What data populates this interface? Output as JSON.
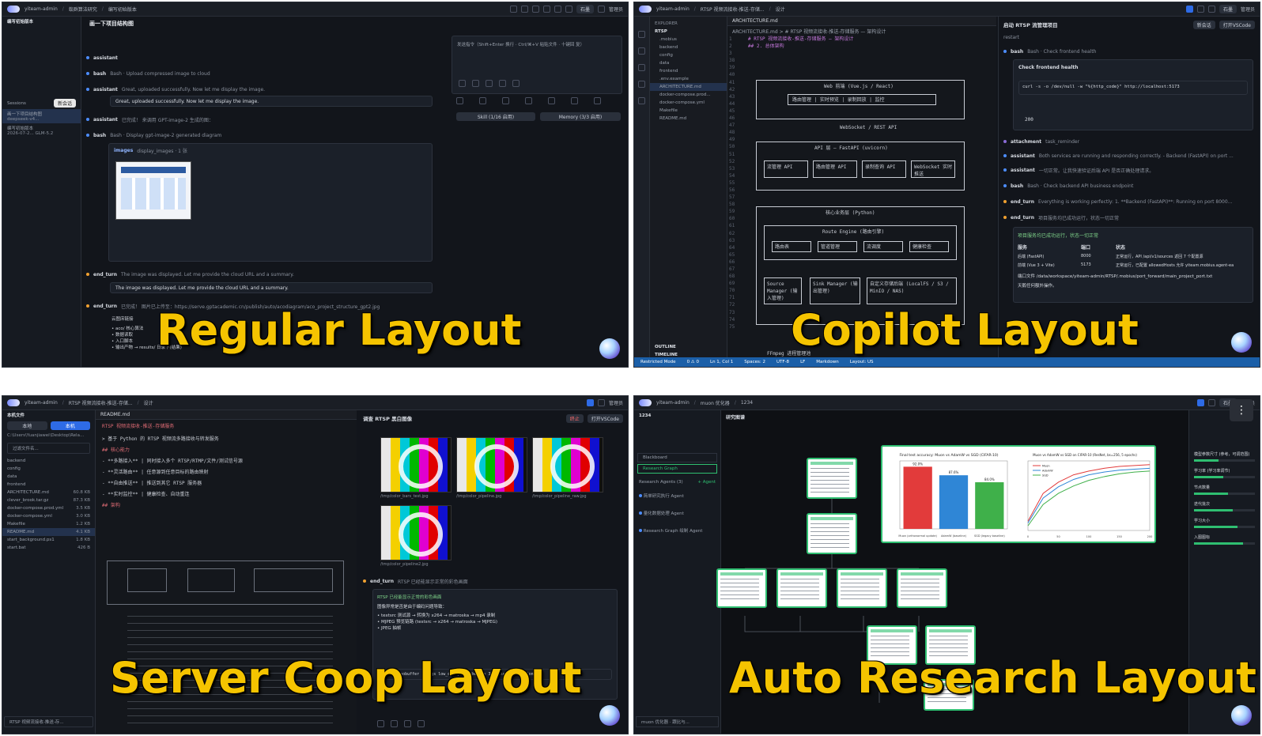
{
  "labels": {
    "regular": "Regular Layout",
    "copilot": "Copilot Layout",
    "coop": "Server Coop Layout",
    "research": "Auto Research Layout"
  },
  "regular": {
    "crumbs": [
      "yiteam-admin",
      "蚁群算法研究",
      "编写初始版本"
    ],
    "header_title": "编写初始版本",
    "tab_title": "画一下项目结构图",
    "stop_label": "终止",
    "open_vscode": "打开VSCode",
    "admin": "管理员",
    "stone": "石墨",
    "sessions_label": "Sessions",
    "new_session": "新会话",
    "sidebar_items": [
      "画一下项目结构图",
      "编写初始版本"
    ],
    "sidebar_models": [
      "deepseek-v4...",
      "GLM-5.2"
    ],
    "sidebar_date": "2026-07-2...",
    "events": [
      {
        "tag": "assistant",
        "text": ""
      },
      {
        "tag": "bash",
        "text": "Bash · Upload compressed image to cloud"
      },
      {
        "tag": "assistant",
        "text": "Great, uploaded successfully. Now let me display the image."
      },
      {
        "tag": "assistant",
        "text": "已完成！ 来调用 GPT-image-2 生成的图："
      },
      {
        "tag": "bash",
        "text": "Bash · Display gpt-image-2 generated diagram"
      },
      {
        "tag": "images",
        "text": "display_images · 1 张"
      },
      {
        "tag": "end_turn",
        "text": "The image was displayed. Let me provide the cloud URL and a summary."
      },
      {
        "tag": "end_turn",
        "text": "已完成！ 图片已上传至：https://serve.gptacademic.cn/publish/auto/acodiagram/aco_project_structure_gpt2.jpg"
      }
    ],
    "result_line": "Great, uploaded successfully. Now let me display the image.",
    "result_line2": "The image was displayed. Let me provide the cloud URL and a summary.",
    "url_label": "云图床链接",
    "bullets": [
      "aco/ 核心算法",
      "数据读取",
      "入口脚本",
      "输出产物 → results/ 日录下(结果)"
    ],
    "input_placeholder": "发送指令（Shift+Enter 换行 · Ctrl/⌘+V 粘贴文件 · 十键回 复）",
    "skill": "Skill (1/16 启用)",
    "memory": "Memory (3/3 启用)"
  },
  "copilot": {
    "crumbs": [
      "yiteam-admin",
      "RTSP 视频流接收-推送-存储...",
      "设计"
    ],
    "explorer": "EXPLORER",
    "rtsp": "RTSP",
    "tree": [
      ".mobius",
      "backend",
      "config",
      "data",
      "frontend",
      ".env.example",
      "ARCHITECTURE.md",
      "docker-compose.prod...",
      "docker-compose.yml",
      "Makefile",
      "README.md"
    ],
    "outline": "OUTLINE",
    "timeline": "TIMELINE",
    "tab": "ARCHITECTURE.md",
    "path": "ARCHITECTURE.md > # RTSP 视频流接收-推送-存储服务 — 架构设计",
    "line1": "# RTSP 视频流接收-推送-存储服务 — 架构设计",
    "line2": "## 2. 总体架构",
    "web": "Web 前端 (Vue.js / React)",
    "web_sub": "路由管理 | 实时预览 | 录制回放 | 监控",
    "ws": "WebSocket / REST API",
    "api": "API 层 — FastAPI (uvicorn)",
    "apis": [
      "流管理 API",
      "路由管理 API",
      "录制查询 API",
      "WebSocket 实时推送"
    ],
    "core": "核心业务层 (Python)",
    "route": "Route Engine (路由引擎)",
    "route_items": [
      "路由表",
      "管道管理",
      "流调度",
      "健康检查"
    ],
    "src": "Source Manager (输入管理)",
    "sink": "Sink Manager (输出管理)",
    "store": "自定义存储后端 (LocalFS / S3 / MinIO / NAS)",
    "ffmpeg": "FFmpeg 进程管理池",
    "status": [
      "Restricted Mode",
      "0 ⚠ 0",
      "Ln 1, Col 1",
      "Spaces: 2",
      "UTF-8",
      "LF",
      "Markdown",
      "Layout: US"
    ],
    "panel_title": "启动 RTSP 流管理项目",
    "panel_add": "新会话",
    "panel_restart": "restart",
    "check_title": "Check frontend health",
    "curl": "curl -s -o /dev/null -w \"%{http_code}\" http://localhost:5173",
    "code200": "200",
    "events": [
      {
        "tag": "bash",
        "text": "Bash · Check frontend health"
      },
      {
        "tag": "attachment",
        "text": "task_reminder"
      },
      {
        "tag": "assistant",
        "text": "Both services are running and responding correctly. - Backend (FastAPI) on port ..."
      },
      {
        "tag": "assistant",
        "text": "一切正常。让我快速验证后端 API 是否正确处理请求。"
      },
      {
        "tag": "bash",
        "text": "Bash · Check backend API business endpoint"
      },
      {
        "tag": "end_turn",
        "text": "Everything is working perfectly: 1. **Backend (FastAPI)**: Running on port 8000..."
      },
      {
        "tag": "end_turn",
        "text": "项目服务均已成功运行，状态一切正常"
      }
    ],
    "table_head": [
      "服务",
      "端口",
      "状态"
    ],
    "table_rows": [
      [
        "后端 (FastAPI)",
        "8000",
        "正常运行，API /api/v1/sources 返回 7 个配置源"
      ],
      [
        "前端 (Vue 3 + Vite)",
        "5173",
        "正常运行，已配置 allowedHosts 允许 yiteam.mobius.agent-ea"
      ]
    ],
    "port_file": "端口文件 /data/workspace/yiteam-admin/RTSP/.mobius/port_forward/main_project_port.txt",
    "ready": "天鹅任何额外操作。"
  },
  "coop": {
    "crumbs": [
      "yiteam-admin",
      "RTSP 视频流接收-推送-存储...",
      "设计"
    ],
    "files_label": "本机文件",
    "tabs": [
      "本地",
      "本机"
    ],
    "path": "C:\\Users\\Yuanjiawei\\Desktop\\Rela...",
    "filter": "过滤文件名...",
    "tree": [
      "backend",
      "config",
      "data",
      "frontend",
      "ARCHITECTURE.md",
      "clever_brook.tar.gz",
      "docker-compose.prod.yml",
      "docker-compose.yml",
      "Makefile",
      "README.md",
      "start_background.ps1",
      "start.bat"
    ],
    "sizes": [
      "",
      "",
      "",
      "",
      "60.8 KB",
      "87.3 KB",
      "3.5 KB",
      "3.0 KB",
      "1.2 KB",
      "4.1 KB",
      "1.8 KB",
      "426 B"
    ],
    "session": "RTSP 视频流接收-推送-存...",
    "editor_tab": "README.md",
    "readme_title": "RTSP 视频流接收-推送-存储服务",
    "readme_lines": [
      "> 基于 Python 的 RTSP 视频流多路接收与转发服务",
      "## 核心能力",
      "- **多路接入** | 同时接入多个 RTSP/RTMP/文件/测试信号源",
      "- **灵活路由** | 任意源到任意目标的路由映射",
      "- **自由推送** | 推送到其它 RTSP 服务器",
      "- **实时监控** | 健康检查、自动重连",
      "## 架构"
    ],
    "right_title": "调查 RTSP 黑白图像",
    "img_captions": [
      "/tmp/color_bars_test.jpg",
      "/tmp/color_pipeline.jpg",
      "/tmp/color_pipeline_raw.jpg",
      "/tmp/color_pipeline2.jpg"
    ],
    "end_turn": "end_turn",
    "end_text": "RTSP 已经能显示正常的彩色画面",
    "fix_title": "图像异常是否是由于编码问题导致：",
    "fix_lines": [
      "textsrc 测试源 → 转换为 x264 → matroska → mp4 录制",
      "MJPEG 预览链路 (testsrc → x264 → matroska → MJPEG)",
      "JPEG 抽帧"
    ],
    "cmd": "-fflags nobuffer -flags low_delay -probesize 32 -analyzeduration 0"
  },
  "research": {
    "crumbs": [
      "yiteam-admin",
      "muon 优化器",
      "1234"
    ],
    "session_id": "1234",
    "blackboard": "Blackboard",
    "graph": "Research Graph",
    "agents_label": "Research Agents (3)",
    "add_agent": "+ Agent",
    "agents": [
      "简单研究执行 Agent",
      "量化数据处理 Agent",
      "Research Graph 绘制 Agent"
    ],
    "canvas_title": "研究图谱",
    "chart1_title": "Final test accuracy: Muon vs AdamW vs SGD (CIFAR-10)",
    "chart2_title": "Muon vs AdamW vs SGD on CIFAR-10 (ResNet, bs=256, 5 epochs)",
    "session_bottom": "muon 优化器 · 跟比与...",
    "right_labels": [
      "模型参数尺寸 (参考，可调范围)",
      "学习率 (学习率调节)",
      "节点数量",
      "迭代批次",
      "学习大小",
      "入图图标"
    ]
  },
  "chart_data": [
    {
      "type": "bar",
      "title": "Final test accuracy: Muon vs AdamW vs SGD (CIFAR-10)",
      "categories": [
        "Muon (orthonormal update)",
        "AdamW (baseline)",
        "SGD (legacy baseline)"
      ],
      "values": [
        92.0,
        87.6,
        84.0
      ],
      "colors": [
        "#e23b3b",
        "#2f86d6",
        "#3fb04a"
      ],
      "ylim": [
        60,
        95
      ]
    },
    {
      "type": "line",
      "title": "Muon vs AdamW vs SGD on CIFAR-10 (ResNet, bs=256, 5 epochs)",
      "x": [
        0,
        25,
        50,
        75,
        100,
        125,
        150,
        175,
        200
      ],
      "series": [
        {
          "name": "Muon",
          "values": [
            30,
            60,
            72,
            80,
            84,
            87,
            89,
            90,
            91
          ],
          "color": "#e23b3b"
        },
        {
          "name": "AdamW",
          "values": [
            28,
            55,
            67,
            75,
            80,
            83,
            85,
            86,
            87
          ],
          "color": "#2f86d6"
        },
        {
          "name": "SGD",
          "values": [
            25,
            48,
            60,
            68,
            74,
            78,
            81,
            83,
            84
          ],
          "color": "#3fb04a"
        }
      ],
      "ylim": [
        20,
        95
      ]
    }
  ]
}
